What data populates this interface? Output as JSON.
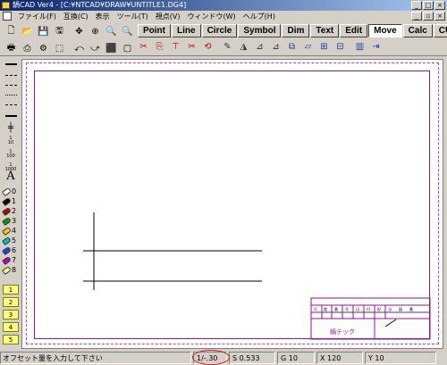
{
  "titlebar": {
    "title": "鍋CAD Ver4 - [C:¥NTCAD¥DRAW¥UNTITLE1.DG4]",
    "buttons": [
      "_",
      "□",
      "×"
    ]
  },
  "menubar": {
    "items": [
      "ファイル(F)",
      "互換(C)",
      "表示",
      "ツール(T)",
      "視点(V)",
      "ウィンドウ(W)",
      "ヘルプ(H)"
    ],
    "mdi_buttons": [
      "_",
      "▫",
      "×"
    ]
  },
  "toolbar": {
    "row1": [
      "🗋",
      "📂",
      "💾",
      "🖫",
      "✥",
      "⊕",
      "🔍",
      "🔍"
    ],
    "row2": [
      "🖶",
      "⎙",
      "⚙",
      "⬚",
      "⤺",
      "⤻",
      "⬛",
      "▢"
    ]
  },
  "tabs": [
    "Point",
    "Line",
    "Circle",
    "Symbol",
    "Dim",
    "Text",
    "Edit",
    "Move",
    "Calc",
    "CUT"
  ],
  "active_tab": "Move",
  "move_icons": [
    "✂",
    "⎘",
    "⊤",
    "✂",
    "⟲",
    "✎",
    "◮",
    "⊿",
    "⊿",
    "⧉",
    "▱",
    "⊞",
    "⊟",
    "▥",
    "⇥"
  ],
  "left_tools": {
    "scales": [
      "1\n10",
      "1\n100",
      "1\n1000"
    ],
    "text_tool": "A",
    "pens": [
      {
        "label": "0",
        "color": "#ffffff"
      },
      {
        "label": "1",
        "color": "#000000"
      },
      {
        "label": "2",
        "color": "#c00000"
      },
      {
        "label": "3",
        "color": "#00a000"
      },
      {
        "label": "4",
        "color": "#ffd000"
      },
      {
        "label": "5",
        "color": "#00c0c0"
      },
      {
        "label": "6",
        "color": "#2040ff"
      },
      {
        "label": "7",
        "color": "#c000c0"
      },
      {
        "label": "8",
        "color": "#ffff80"
      }
    ],
    "layers": [
      "1",
      "2",
      "3",
      "4",
      "5"
    ]
  },
  "drawing": {
    "title_block": {
      "row_labels": [
        "尺",
        "度",
        "番",
        "号",
        "日",
        "付",
        "担",
        "当",
        "図",
        "番"
      ],
      "company": "鍋テック"
    },
    "colors": {
      "frame": "#8a1a8a",
      "border_dash": "#c43cc4",
      "lines": "#000000"
    }
  },
  "statusbar": {
    "message": "オフセット量を入力して下さい",
    "zoom": "1/-.30",
    "s": "S 0.533",
    "g": "G 10",
    "x": "X 120",
    "y": "Y 10"
  }
}
